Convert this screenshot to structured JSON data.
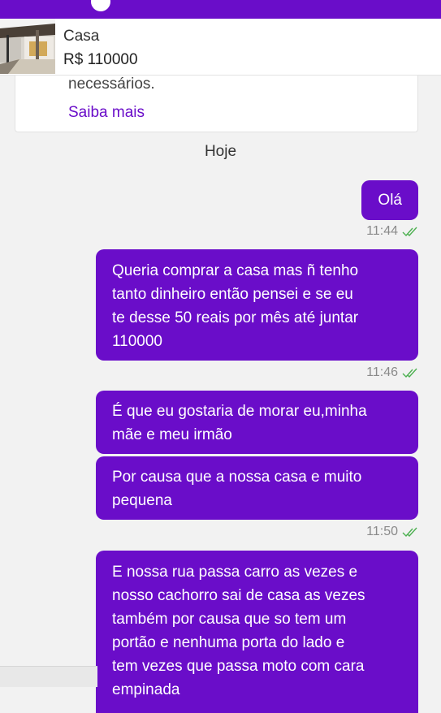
{
  "colors": {
    "accent": "#6a0dc9",
    "read_receipt": "#4cb050",
    "background": "#f2f2f2"
  },
  "listing": {
    "title": "Casa",
    "price": "R$ 110000"
  },
  "info_card": {
    "text": "necessários.",
    "link": "Saiba mais"
  },
  "date_separator": "Hoje",
  "messages": [
    {
      "text": "Olá",
      "time": "11:44",
      "status_icon": "double-check-icon"
    },
    {
      "text": "Queria comprar a casa mas ñ tenho\ntanto dinheiro então pensei e se eu\nte desse 50 reais por mês até juntar\n110000",
      "time": "11:46",
      "status_icon": "double-check-icon"
    },
    {
      "text": "É que eu gostaria de morar eu,minha\nmãe e meu irmão"
    },
    {
      "text": "Por causa que a nossa casa e muito\npequena",
      "time": "11:50",
      "status_icon": "double-check-icon"
    },
    {
      "text": "E nossa rua passa carro as vezes e\nnosso cachorro sai de casa as vezes\ntambém  por causa que so tem um\nportão e nenhuma porta do lado e\ntem vezes que passa moto com cara\nempinada"
    }
  ]
}
